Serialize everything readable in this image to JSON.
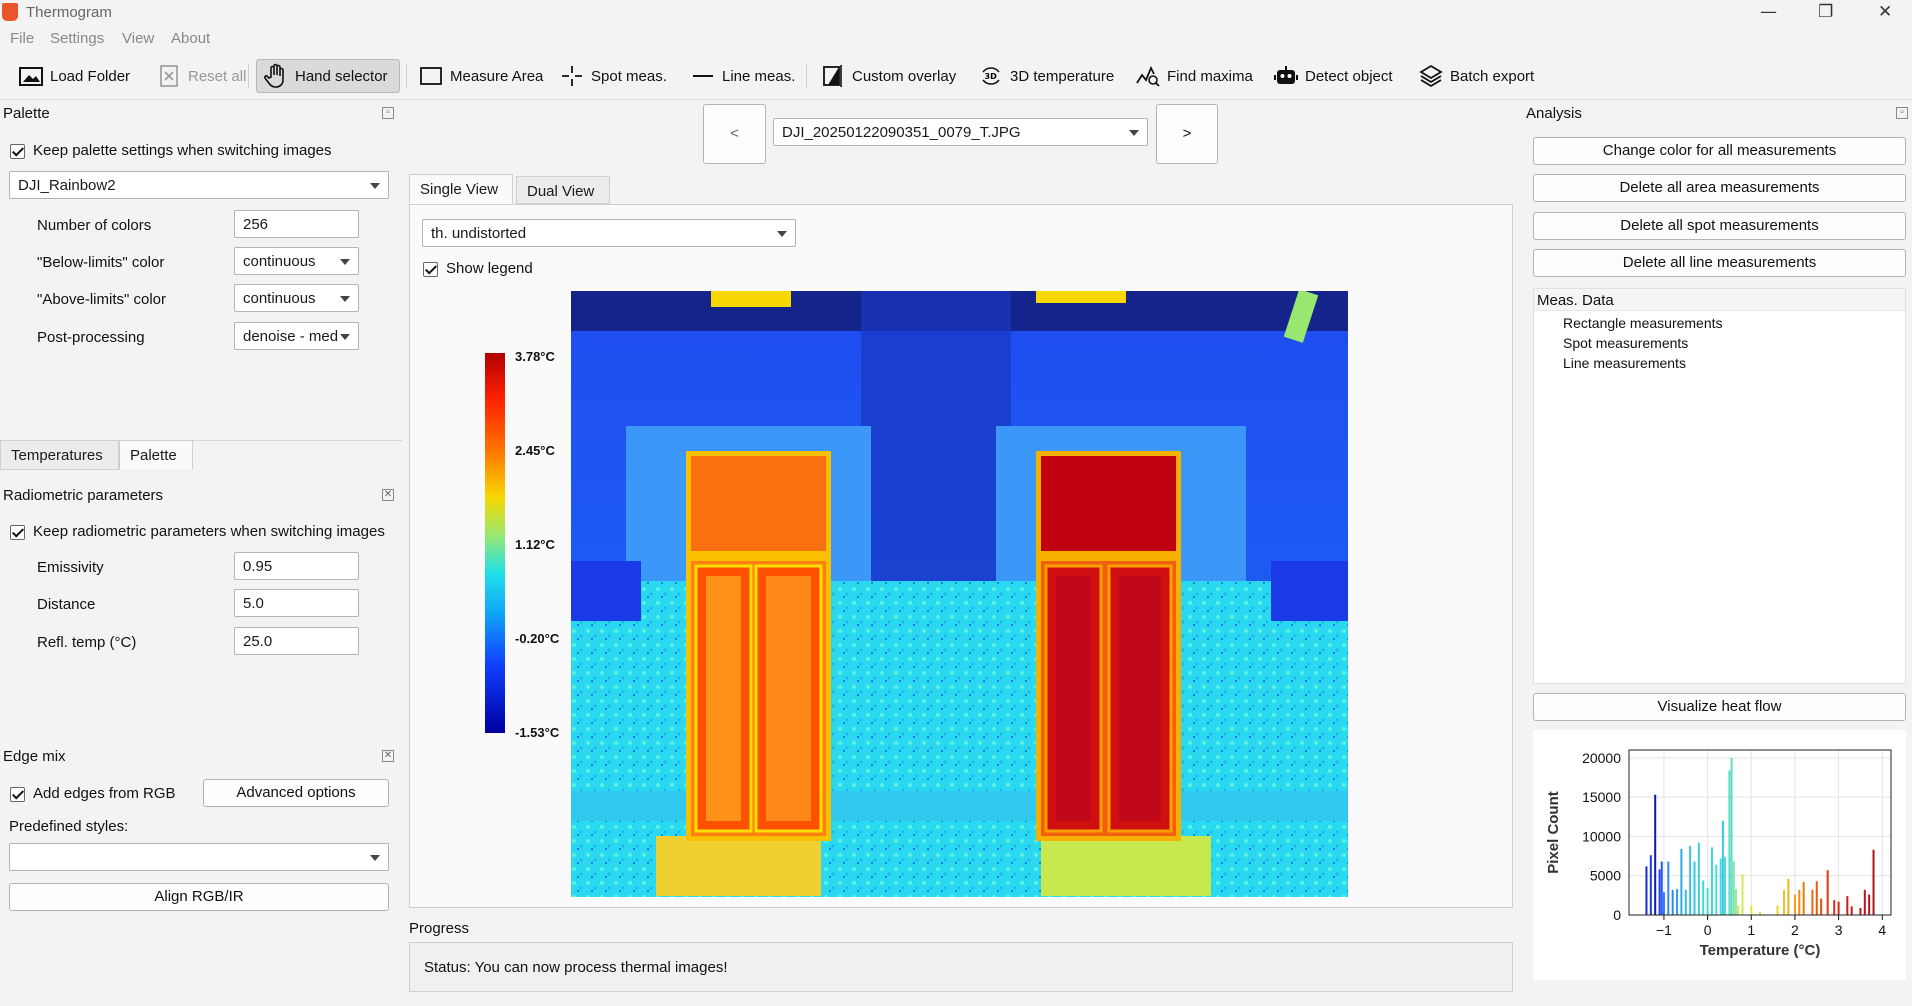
{
  "window": {
    "title": "Thermogram",
    "controls": [
      "—",
      "❐",
      "✕"
    ]
  },
  "menu": [
    "File",
    "Settings",
    "View",
    "About"
  ],
  "toolbar": {
    "load_folder": "Load Folder",
    "reset_all": "Reset all",
    "hand_selector": "Hand selector",
    "measure_area": "Measure Area",
    "spot_meas": "Spot meas.",
    "line_meas": "Line meas.",
    "custom_overlay": "Custom overlay",
    "temperature_3d": "3D temperature",
    "find_maxima": "Find maxima",
    "detect_object": "Detect object",
    "batch_export": "Batch export",
    "icon_3d_text": "3D"
  },
  "palette_panel": {
    "title": "Palette",
    "keep_settings": "Keep palette settings when switching images",
    "palette_name": "DJI_Rainbow2",
    "num_colors_label": "Number of colors",
    "num_colors": "256",
    "below_label": "\"Below-limits\" color",
    "below_value": "continuous",
    "above_label": "\"Above-limits\" color",
    "above_value": "continuous",
    "post_label": "Post-processing",
    "post_value": "denoise - med"
  },
  "left_tabs": [
    "Temperatures",
    "Palette"
  ],
  "radiometric": {
    "title": "Radiometric parameters",
    "keep": "Keep radiometric parameters when switching images",
    "emissivity_label": "Emissivity",
    "emissivity": "0.95",
    "distance_label": "Distance",
    "distance": "5.0",
    "refl_label": "Refl. temp (°C)",
    "refl": "25.0"
  },
  "edge_mix": {
    "title": "Edge mix",
    "add_edges": "Add edges from RGB",
    "advanced": "Advanced  options",
    "predefined": "Predefined styles:",
    "style_value": "",
    "align": "Align RGB/IR"
  },
  "nav": {
    "prev": "<",
    "next": ">",
    "file": "DJI_20250122090351_0079_T.JPG"
  },
  "view_tabs": [
    "Single View",
    "Dual View"
  ],
  "view_mode": "th. undistorted",
  "show_legend": "Show legend",
  "legend": [
    "3.78°C",
    "2.45°C",
    "1.12°C",
    "-0.20°C",
    "-1.53°C"
  ],
  "progress": {
    "title": "Progress",
    "status": "Status: You can now process thermal images!"
  },
  "analysis": {
    "title": "Analysis",
    "change_color": "Change color for all measurements",
    "delete_area": "Delete all area measurements",
    "delete_spot": "Delete all spot measurements",
    "delete_line": "Delete all line measurements",
    "meas_header": "Meas. Data",
    "tree": [
      "Rectangle measurements",
      "Spot measurements",
      "Line measurements"
    ],
    "heat_flow": "Visualize heat flow"
  },
  "colors": {
    "accent": "#0078d4",
    "bg": "#f3f3f3"
  },
  "chart_data": {
    "type": "bar",
    "xlabel": "Temperature (°C)",
    "ylabel": "Pixel Count",
    "xlim": [
      -1.8,
      4.2
    ],
    "ylim": [
      0,
      21000
    ],
    "xticks": [
      "−1",
      "0",
      "1",
      "2",
      "3",
      "4"
    ],
    "xtick_values": [
      -1,
      0,
      1,
      2,
      3,
      4
    ],
    "yticks": [
      "0",
      "5000",
      "10000",
      "15000",
      "20000"
    ],
    "ytick_values": [
      0,
      5000,
      10000,
      15000,
      20000
    ],
    "x": [
      -1.4,
      -1.3,
      -1.2,
      -1.1,
      -1.05,
      -1.0,
      -0.9,
      -0.8,
      -0.7,
      -0.6,
      -0.5,
      -0.4,
      -0.3,
      -0.2,
      -0.1,
      0.0,
      0.1,
      0.2,
      0.3,
      0.35,
      0.4,
      0.5,
      0.55,
      0.6,
      0.65,
      0.7,
      0.8,
      1.0,
      1.2,
      1.6,
      1.75,
      1.85,
      2.0,
      2.1,
      2.2,
      2.4,
      2.5,
      2.6,
      2.75,
      2.9,
      3.0,
      3.2,
      3.3,
      3.5,
      3.6,
      3.7,
      3.8
    ],
    "values": [
      6200,
      7600,
      15300,
      5800,
      6800,
      2900,
      6800,
      3200,
      3300,
      8400,
      3200,
      8800,
      6800,
      9200,
      4400,
      3400,
      8600,
      6400,
      7200,
      12000,
      7400,
      18400,
      20000,
      6800,
      3300,
      1200,
      5200,
      1200,
      400,
      1200,
      3200,
      4600,
      2600,
      3200,
      4200,
      3200,
      4300,
      2100,
      5700,
      1900,
      1700,
      2400,
      1100,
      900,
      3200,
      2600,
      8300
    ],
    "colors": [
      "#1a2bd8",
      "#1a3bf0",
      "#0a18b8",
      "#1f45f5",
      "#2559f5",
      "#2e70f2",
      "#3188ee",
      "#2c86ee",
      "#2f9aee",
      "#2fa8ec",
      "#3ab5ea",
      "#38c3e8",
      "#33c8e0",
      "#3ccfdc",
      "#3fd6d2",
      "#47d8c8",
      "#3bd8d8",
      "#48dcd2",
      "#4ad8e0",
      "#35c8e8",
      "#55d8ce",
      "#5adcc8",
      "#62e0c0",
      "#80e4b0",
      "#a0e890",
      "#c0ee70",
      "#d6e860",
      "#e8e040",
      "#eed838",
      "#f2d030",
      "#f4c028",
      "#f4b020",
      "#f2a018",
      "#f28a10",
      "#f07a10",
      "#ee6a10",
      "#ec5a0e",
      "#e84a0c",
      "#e43a0c",
      "#de2e0c",
      "#d82410",
      "#cc1c12",
      "#c41814",
      "#bc1416",
      "#b81418",
      "#b21418",
      "#aa1418"
    ]
  }
}
